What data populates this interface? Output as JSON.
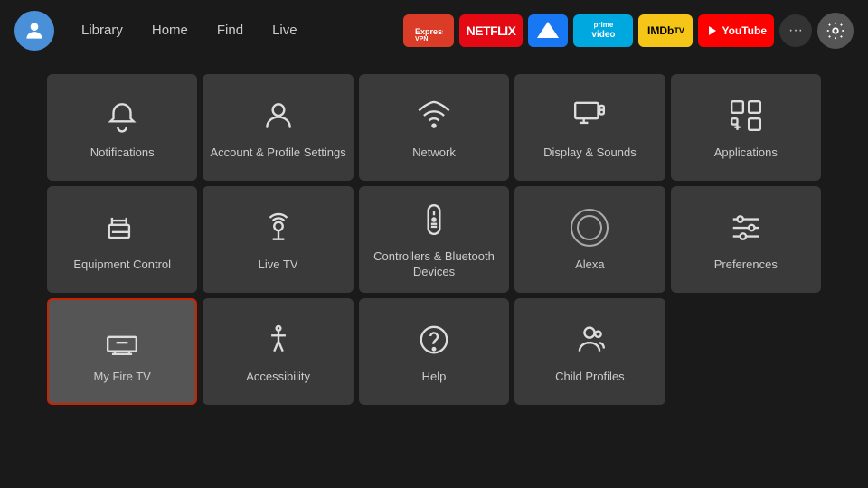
{
  "nav": {
    "links": [
      "Library",
      "Home",
      "Find",
      "Live"
    ],
    "apps": [
      {
        "id": "expressvpn",
        "label": "ExpressVPN",
        "class": "app-expressvpn"
      },
      {
        "id": "netflix",
        "label": "NETFLIX",
        "class": "app-netflix"
      },
      {
        "id": "fbprime",
        "label": "🦅",
        "class": "app-fbprime"
      },
      {
        "id": "primevideo",
        "label": "prime video",
        "class": "app-primevideo"
      },
      {
        "id": "imdb",
        "label": "IMDbTV",
        "class": "app-imdb"
      },
      {
        "id": "youtube",
        "label": "▶ YouTube",
        "class": "app-youtube"
      }
    ],
    "more_label": "•••",
    "settings_label": "⚙"
  },
  "grid": {
    "cells": [
      {
        "id": "notifications",
        "label": "Notifications",
        "icon": "bell"
      },
      {
        "id": "account-profile",
        "label": "Account & Profile Settings",
        "icon": "person"
      },
      {
        "id": "network",
        "label": "Network",
        "icon": "wifi"
      },
      {
        "id": "display-sounds",
        "label": "Display & Sounds",
        "icon": "monitor-speaker"
      },
      {
        "id": "applications",
        "label": "Applications",
        "icon": "apps"
      },
      {
        "id": "equipment-control",
        "label": "Equipment Control",
        "icon": "tv-remote"
      },
      {
        "id": "live-tv",
        "label": "Live TV",
        "icon": "antenna"
      },
      {
        "id": "controllers-bluetooth",
        "label": "Controllers & Bluetooth Devices",
        "icon": "remote"
      },
      {
        "id": "alexa",
        "label": "Alexa",
        "icon": "alexa"
      },
      {
        "id": "preferences",
        "label": "Preferences",
        "icon": "sliders"
      },
      {
        "id": "my-fire-tv",
        "label": "My Fire TV",
        "icon": "firetv",
        "selected": true
      },
      {
        "id": "accessibility",
        "label": "Accessibility",
        "icon": "accessibility"
      },
      {
        "id": "help",
        "label": "Help",
        "icon": "help"
      },
      {
        "id": "child-profiles",
        "label": "Child Profiles",
        "icon": "child"
      }
    ]
  }
}
